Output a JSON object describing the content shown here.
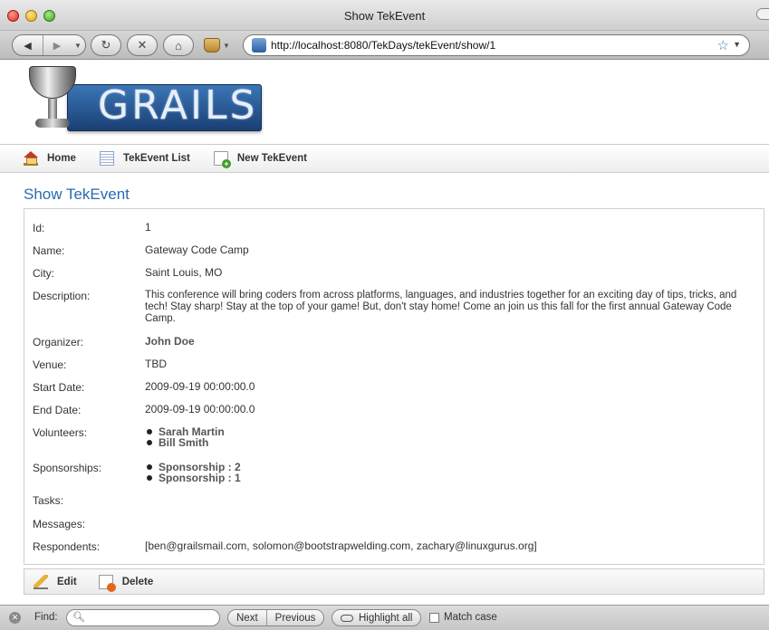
{
  "window": {
    "title": "Show TekEvent"
  },
  "browser": {
    "url": "http://localhost:8080/TekDays/tekEvent/show/1"
  },
  "logo": {
    "text": "GRAILS"
  },
  "nav": {
    "items": [
      {
        "label": "Home",
        "icon": "home-icon"
      },
      {
        "label": "TekEvent List",
        "icon": "list-icon"
      },
      {
        "label": "New TekEvent",
        "icon": "new-document-icon"
      }
    ]
  },
  "page": {
    "title": "Show TekEvent",
    "fields": {
      "id": {
        "label": "Id:",
        "value": "1"
      },
      "name": {
        "label": "Name:",
        "value": "Gateway Code Camp"
      },
      "city": {
        "label": "City:",
        "value": "Saint Louis, MO"
      },
      "description": {
        "label": "Description:",
        "value": "This conference will bring coders from across platforms, languages, and industries together for an exciting day of tips, tricks, and tech! Stay sharp! Stay at the top of your game! But, don't stay home! Come an join us this fall for the first annual Gateway Code Camp."
      },
      "organizer": {
        "label": "Organizer:",
        "value": "John Doe"
      },
      "venue": {
        "label": "Venue:",
        "value": "TBD"
      },
      "start_date": {
        "label": "Start Date:",
        "value": "2009-09-19 00:00:00.0"
      },
      "end_date": {
        "label": "End Date:",
        "value": "2009-09-19 00:00:00.0"
      },
      "volunteers": {
        "label": "Volunteers:",
        "items": [
          "Sarah Martin",
          "Bill Smith"
        ]
      },
      "sponsorships": {
        "label": "Sponsorships:",
        "items": [
          "Sponsorship : 2",
          "Sponsorship : 1"
        ]
      },
      "tasks": {
        "label": "Tasks:"
      },
      "messages": {
        "label": "Messages:"
      },
      "respondents": {
        "label": "Respondents:",
        "value": "[ben@grailsmail.com, solomon@bootstrapwelding.com, zachary@linuxgurus.org]"
      }
    },
    "buttons": {
      "edit": "Edit",
      "delete": "Delete"
    }
  },
  "findbar": {
    "label": "Find:",
    "value": "",
    "next": "Next",
    "previous": "Previous",
    "highlight_all": "Highlight all",
    "match_case": "Match case"
  }
}
